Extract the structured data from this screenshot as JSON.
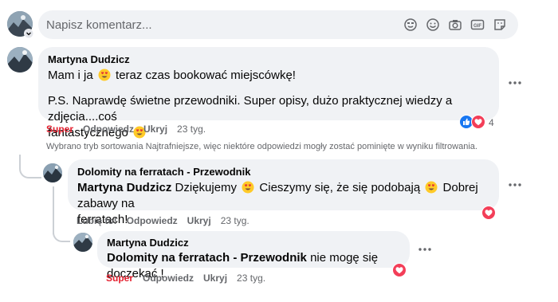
{
  "composer": {
    "placeholder": "Napisz komentarz...",
    "icons": [
      "sticker-face-icon",
      "emoji-icon",
      "camera-icon",
      "gif-icon",
      "sticker-icon"
    ]
  },
  "comments": [
    {
      "author": "Martyna Dudzicz",
      "line1_before": "Mam i ja",
      "line1_emoji": "heart-eyes",
      "line1_after": "teraz czas bookować miejscówkę!",
      "line2": "P.S. Naprawdę świetne przewodniki. Super opisy, dużo praktycznej wiedzy a zdjęcia....coś",
      "line3": "fantastycznego",
      "line3_emoji": "heart-eyes",
      "actions": {
        "reaction": "Super",
        "reply": "Odpowiedz",
        "hide": "Ukryj",
        "time": "23 tyg."
      },
      "reactions": {
        "types": [
          "like",
          "love"
        ],
        "count": "4"
      }
    }
  ],
  "sort_note": "Wybrano tryb sortowania Najtrafniejsze, więc niektóre odpowiedzi mogły zostać pominięte w wyniku filtrowania.",
  "replies": [
    {
      "author": "Dolomity na ferratach - Przewodnik",
      "mention": "Martyna Dudzicz",
      "t1": "Dziękujemy",
      "t2": "Cieszymy się, że się podobają",
      "t3": "Dobrej zabawy na",
      "t4": "ferratach!",
      "actions": {
        "reaction": "Lubię to!",
        "reply": "Odpowiedz",
        "hide": "Ukryj",
        "time": "23 tyg."
      },
      "reactions": {
        "types": [
          "love"
        ]
      }
    },
    {
      "author": "Martyna Dudzicz",
      "mention": "Dolomity na ferratach - Przewodnik",
      "text": "nie mogę się doczekać !",
      "actions": {
        "reaction": "Super",
        "reply": "Odpowiedz",
        "hide": "Ukryj",
        "time": "23 tyg."
      },
      "reactions": {
        "types": [
          "love"
        ]
      }
    }
  ],
  "colors": {
    "love": "#f33e58",
    "like": "#1877f2",
    "super_text": "#e4202f",
    "bubble": "#f0f2f5",
    "muted": "#65676b"
  }
}
